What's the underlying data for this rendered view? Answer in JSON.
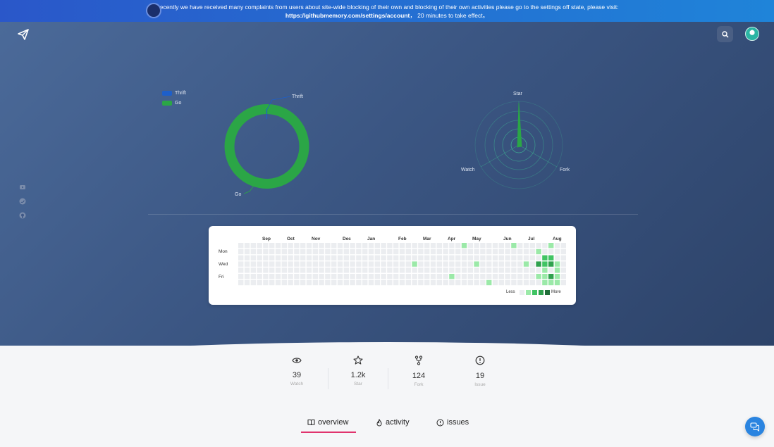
{
  "banner": {
    "line1": "Recently we have received many complaints from users about site-wide blocking of their own and blocking of their own activities please go to the settings off state, please visit:",
    "link": "https://githubmemory.com/settings/account",
    "line2_suffix": "， 20 minutes to take effect。"
  },
  "header": {
    "logo_icon": "paper-plane-icon",
    "search_icon": "search-icon",
    "avatar_icon": "user-avatar"
  },
  "sidebar_social": [
    "youtube-icon",
    "twitter-icon",
    "github-icon"
  ],
  "languages_chart": {
    "legend": [
      {
        "name": "Thrift",
        "color": "#1e5fc9"
      },
      {
        "name": "Go",
        "color": "#2ba646"
      }
    ],
    "labels": {
      "thrift": "Thrift",
      "go": "Go"
    }
  },
  "radar_chart": {
    "labels": {
      "star": "Star",
      "watch": "Watch",
      "fork": "Fork"
    }
  },
  "chart_data": [
    {
      "type": "pie",
      "labels": [
        "Thrift",
        "Go"
      ],
      "values": [
        0.3,
        99.7
      ],
      "colors": [
        "#1e5fc9",
        "#2ba646"
      ]
    },
    {
      "type": "radar",
      "axes": [
        "Star",
        "Fork",
        "Watch"
      ],
      "values": [
        1.2,
        0.12,
        0.04
      ]
    }
  ],
  "contributions": {
    "months": [
      "Sep",
      "Oct",
      "Nov",
      "Dec",
      "Jan",
      "Feb",
      "Mar",
      "Apr",
      "May",
      "Jun",
      "Jul",
      "Aug"
    ],
    "days": [
      "Mon",
      "Wed",
      "Fri"
    ],
    "less": "Less",
    "more": "More",
    "levels": [
      "#ebedf0",
      "#9be9a8",
      "#40c463",
      "#30a14e",
      "#216e39"
    ],
    "active": [
      [
        36,
        0,
        1
      ],
      [
        44,
        0,
        1
      ],
      [
        50,
        0,
        1
      ],
      [
        48,
        1,
        1
      ],
      [
        49,
        2,
        2
      ],
      [
        50,
        2,
        2
      ],
      [
        28,
        3,
        1
      ],
      [
        38,
        3,
        1
      ],
      [
        46,
        3,
        1
      ],
      [
        48,
        3,
        3
      ],
      [
        49,
        3,
        2
      ],
      [
        50,
        3,
        3
      ],
      [
        51,
        3,
        1
      ],
      [
        49,
        4,
        1
      ],
      [
        51,
        4,
        1
      ],
      [
        34,
        5,
        1
      ],
      [
        48,
        5,
        1
      ],
      [
        49,
        5,
        1
      ],
      [
        50,
        5,
        3
      ],
      [
        51,
        5,
        1
      ],
      [
        40,
        6,
        1
      ],
      [
        49,
        6,
        1
      ],
      [
        50,
        6,
        1
      ],
      [
        51,
        6,
        1
      ]
    ]
  },
  "stats": [
    {
      "icon": "eye-icon",
      "value": "39",
      "label": "Watch"
    },
    {
      "icon": "star-icon",
      "value": "1.2k",
      "label": "Star"
    },
    {
      "icon": "fork-icon",
      "value": "124",
      "label": "Fork"
    },
    {
      "icon": "issue-icon",
      "value": "19",
      "label": "Issue"
    }
  ],
  "tabs": [
    {
      "icon": "book-icon",
      "label": "overview",
      "active": true
    },
    {
      "icon": "flame-icon",
      "label": "activity",
      "active": false
    },
    {
      "icon": "issue-icon",
      "label": "issues",
      "active": false
    }
  ],
  "chat_icon": "chat-icon"
}
